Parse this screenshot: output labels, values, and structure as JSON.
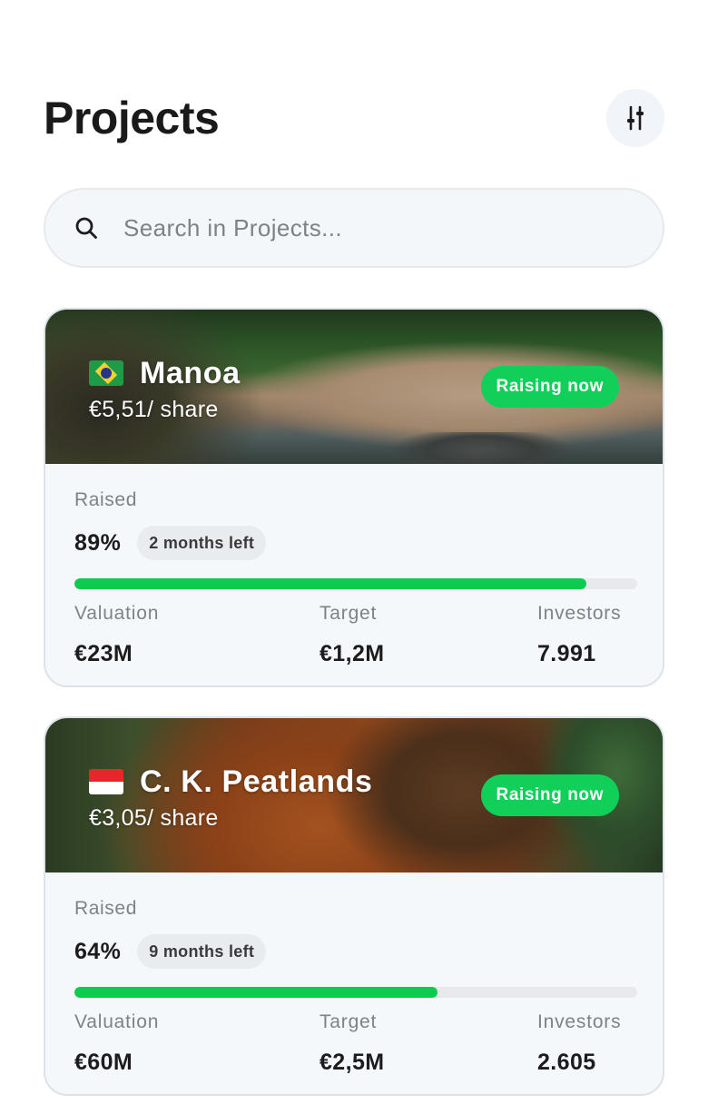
{
  "header": {
    "title": "Projects",
    "filter_icon": "sliders-icon"
  },
  "search": {
    "placeholder": "Search in Projects...",
    "value": "",
    "icon": "search-icon"
  },
  "projects": [
    {
      "name": "Manoa",
      "flag": "brazil-flag-icon",
      "price": "€5,51/ share",
      "status": "Raising now",
      "raised_label": "Raised",
      "raised_percent": "89%",
      "progress": 0.91,
      "time_left": "2 months left",
      "stats": {
        "valuation_label": "Valuation",
        "valuation": "€23M",
        "target_label": "Target",
        "target": "€1,2M",
        "investors_label": "Investors",
        "investors": "7.991"
      }
    },
    {
      "name": "C. K. Peatlands",
      "flag": "indonesia-flag-icon",
      "price": "€3,05/ share",
      "status": "Raising now",
      "raised_label": "Raised",
      "raised_percent": "64%",
      "progress": 0.645,
      "time_left": "9 months left",
      "stats": {
        "valuation_label": "Valuation",
        "valuation": "€60M",
        "target_label": "Target",
        "target": "€2,5M",
        "investors_label": "Investors",
        "investors": "2.605"
      }
    }
  ],
  "colors": {
    "accent_green": "#10d05a",
    "progress_green": "#0ccb4f",
    "card_background": "#f5f8fb",
    "muted_text": "#7d8288"
  }
}
